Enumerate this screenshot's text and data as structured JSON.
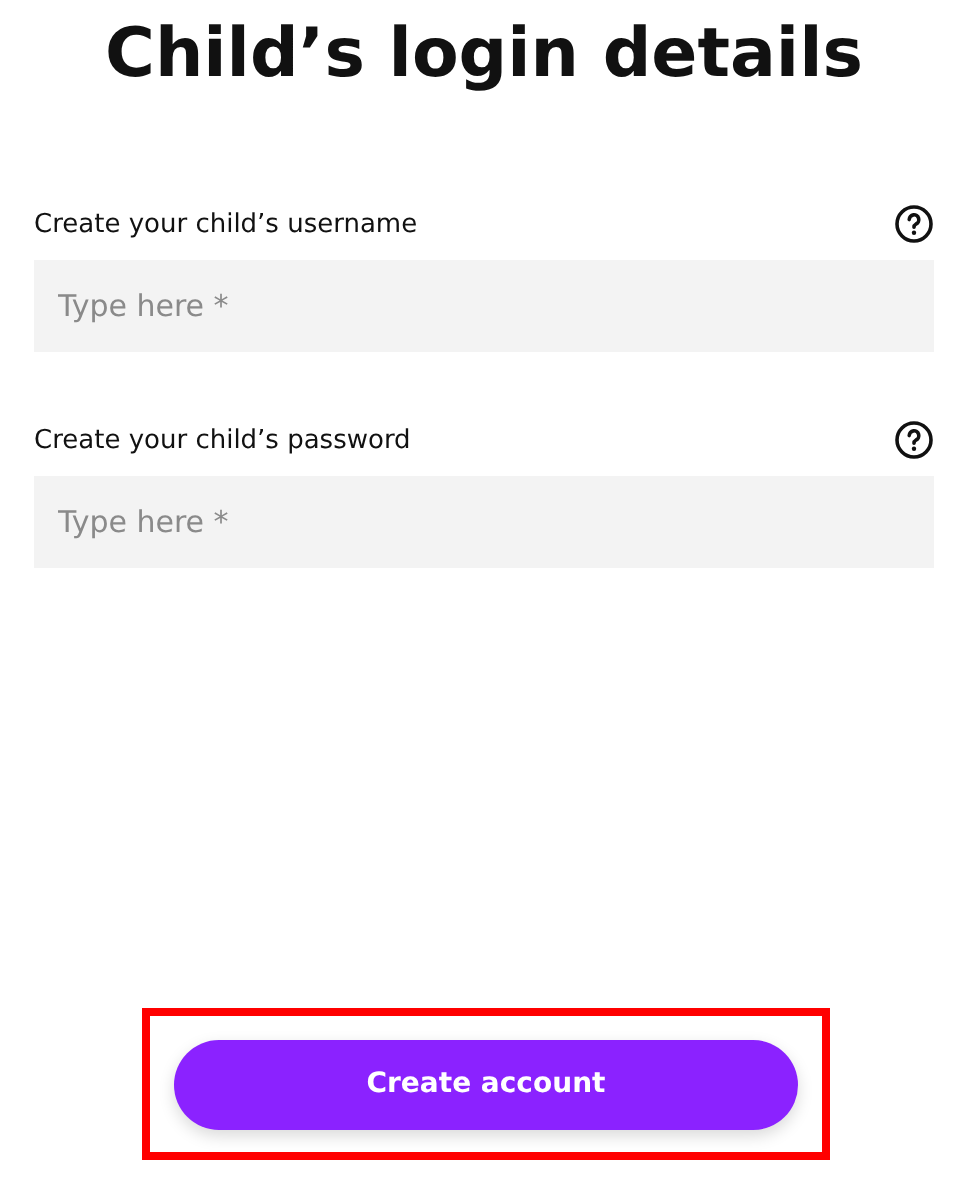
{
  "title": "Child’s login details",
  "fields": [
    {
      "label": "Create your child’s username",
      "placeholder": "Type here *"
    },
    {
      "label": "Create your child’s password",
      "placeholder": "Type here *"
    }
  ],
  "button": "Create account"
}
